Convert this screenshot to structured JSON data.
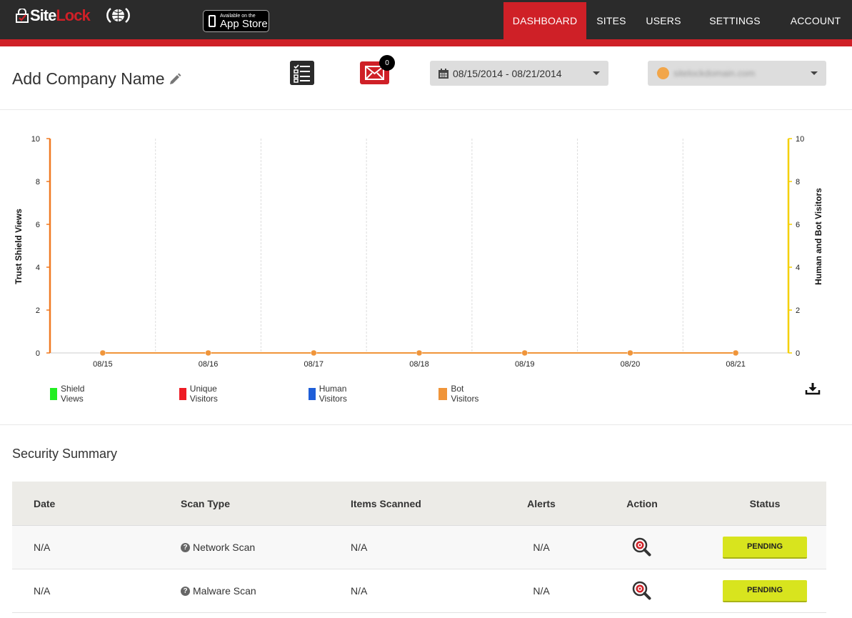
{
  "brand": {
    "logo_text_site": "Site",
    "logo_text_lock": "Lock",
    "accent": "#cf2027",
    "dark": "#2b2b2b"
  },
  "appstore": {
    "line1": "Available on the",
    "line2": "App Store"
  },
  "nav": {
    "items": [
      "DASHBOARD",
      "SITES",
      "USERS",
      "SETTINGS",
      "ACCOUNT"
    ],
    "active": "DASHBOARD"
  },
  "header": {
    "company_name": "Add Company Name",
    "mail_badge": "0",
    "date_range": "08/15/2014 - 08/21/2014",
    "site_selected": "sitelockdomain.com"
  },
  "chart_data": {
    "type": "line",
    "x": [
      "08/15",
      "08/16",
      "08/17",
      "08/18",
      "08/19",
      "08/20",
      "08/21"
    ],
    "ylabel": "Trust Shield Views",
    "y2label": "Human and Bot Visitors",
    "ylim": [
      0,
      10
    ],
    "y2lim": [
      0,
      10
    ],
    "yticks": [
      0,
      2,
      4,
      6,
      8,
      10
    ],
    "series": [
      {
        "name": "Shield Views",
        "color": "#22ee22",
        "values": [
          0,
          0,
          0,
          0,
          0,
          0,
          0
        ]
      },
      {
        "name": "Unique Visitors",
        "color": "#ee1c25",
        "values": [
          0,
          0,
          0,
          0,
          0,
          0,
          0
        ]
      },
      {
        "name": "Human Visitors",
        "color": "#1f5ed8",
        "values": [
          0,
          0,
          0,
          0,
          0,
          0,
          0
        ]
      },
      {
        "name": "Bot Visitors",
        "color": "#f0953a",
        "values": [
          0,
          0,
          0,
          0,
          0,
          0,
          0
        ]
      }
    ],
    "grid": true,
    "legend": "bottom-left"
  },
  "security": {
    "title": "Security Summary",
    "columns": [
      "Date",
      "Scan Type",
      "Items Scanned",
      "Alerts",
      "Action",
      "Status"
    ],
    "rows": [
      {
        "date": "N/A",
        "type": "Network Scan",
        "items": "N/A",
        "alerts": "N/A",
        "status": "PENDING"
      },
      {
        "date": "N/A",
        "type": "Malware Scan",
        "items": "N/A",
        "alerts": "N/A",
        "status": "PENDING"
      }
    ],
    "help_glyph": "?"
  }
}
